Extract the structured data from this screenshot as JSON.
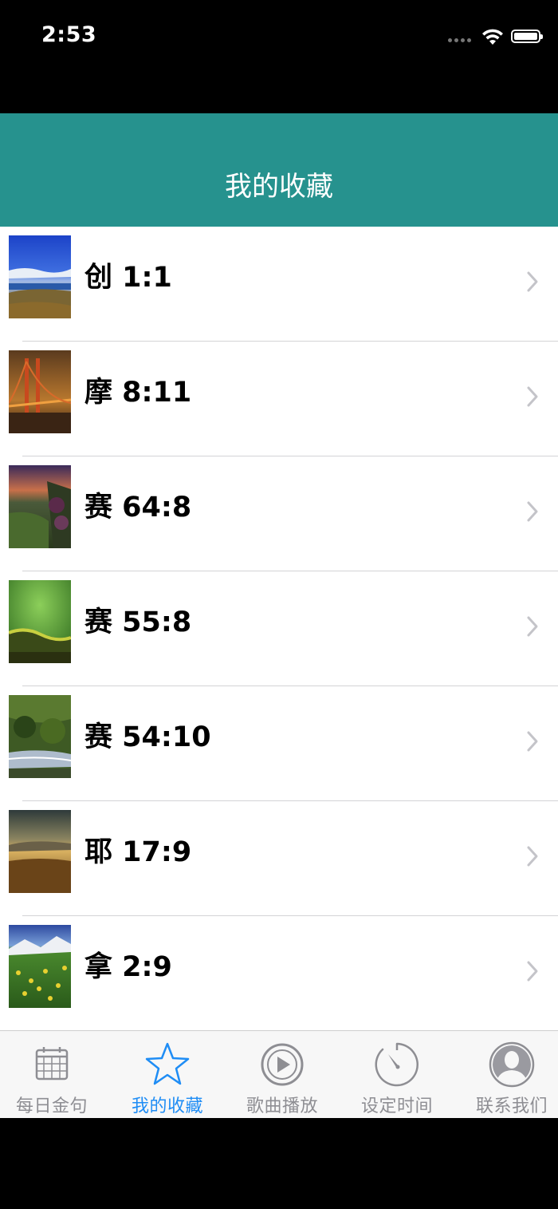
{
  "status_bar": {
    "time": "2:53"
  },
  "nav": {
    "title": "我的收藏"
  },
  "list": {
    "items": [
      {
        "label": "创 1:1"
      },
      {
        "label": "摩 8:11"
      },
      {
        "label": "赛 64:8"
      },
      {
        "label": "赛 55:8"
      },
      {
        "label": "赛 54:10"
      },
      {
        "label": "耶 17:9"
      },
      {
        "label": "拿 2:9"
      }
    ]
  },
  "tab_bar": {
    "active_color": "#1f8df5",
    "inactive_color": "#8e8e93",
    "tabs": [
      {
        "label": "每日金句",
        "icon": "calendar-icon"
      },
      {
        "label": "我的收藏",
        "icon": "star-icon"
      },
      {
        "label": "歌曲播放",
        "icon": "play-icon"
      },
      {
        "label": "设定时间",
        "icon": "timer-icon"
      },
      {
        "label": "联系我们",
        "icon": "contact-icon"
      }
    ]
  },
  "colors": {
    "nav_background": "#26928e",
    "separator": "#d3d3d6"
  }
}
